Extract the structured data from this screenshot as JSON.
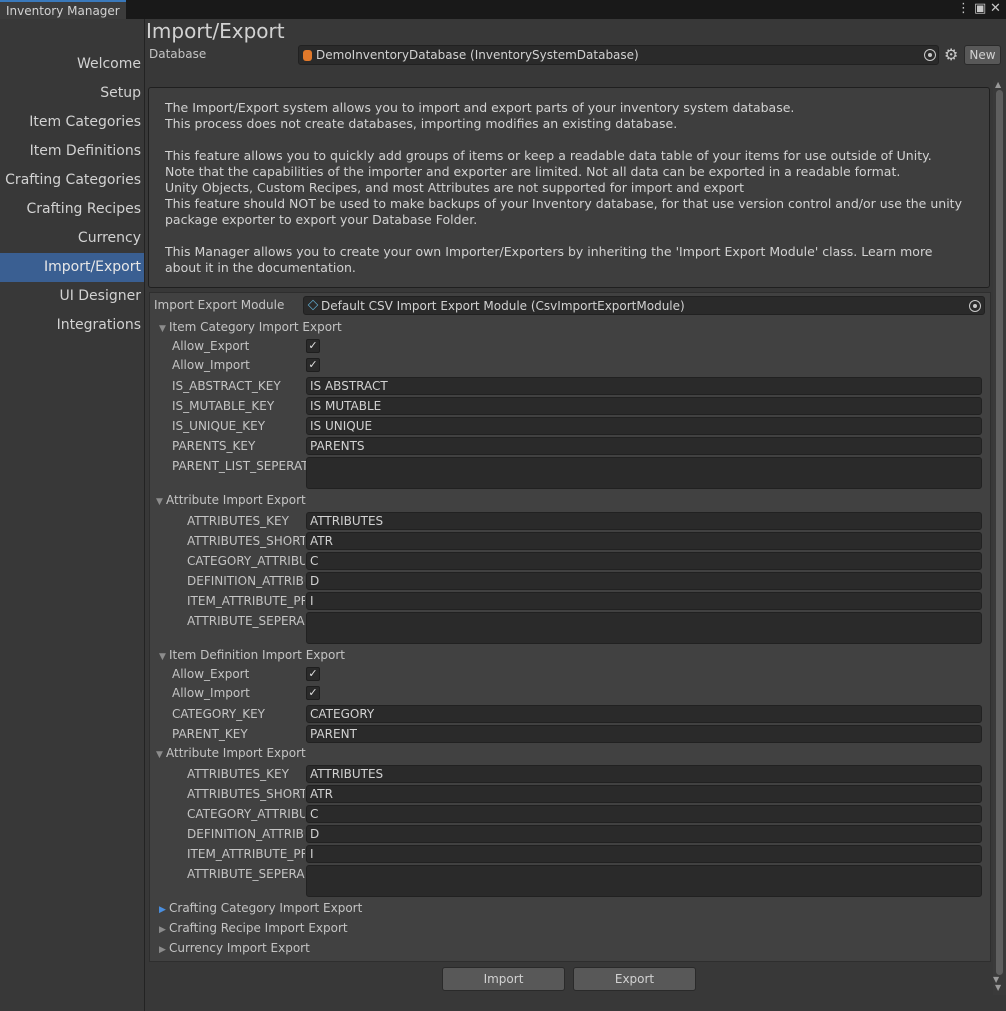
{
  "window": {
    "tab_title": "Inventory Manager",
    "menu_icon": "kebab-menu-icon",
    "maximize_icon": "maximize-icon",
    "close_icon": "close-icon"
  },
  "sidebar": {
    "items": [
      {
        "label": "Welcome"
      },
      {
        "label": "Setup"
      },
      {
        "label": "Item Categories"
      },
      {
        "label": "Item Definitions"
      },
      {
        "label": "Crafting Categories"
      },
      {
        "label": "Crafting Recipes"
      },
      {
        "label": "Currency"
      },
      {
        "label": "Import/Export",
        "active": true
      },
      {
        "label": "UI Designer"
      },
      {
        "label": "Integrations"
      }
    ]
  },
  "header": {
    "title": "Import/Export",
    "database_label": "Database",
    "database_value": "DemoInventoryDatabase (InventorySystemDatabase)",
    "new_button": "New"
  },
  "help": {
    "lines": [
      "The Import/Export system allows you to import and export parts of your inventory system database.",
      "This process does not create databases, importing modifies an existing database.",
      "",
      "This feature allows you to quickly add groups of items or keep a readable data table of your items for use outside of Unity.",
      "Note that the capabilities of the importer and exporter are limited. Not all data can be exported in a readable format.",
      "Unity Objects, Custom Recipes, and most Attributes are not supported for import and export",
      "This feature should NOT be used to make backups of your Inventory database, for that use version control and/or use the unity",
      "package exporter to export your Database Folder.",
      "",
      "This Manager allows you to create your own Importer/Exporters by inheriting the 'Import Export Module' class. Learn more",
      "about it in the documentation."
    ]
  },
  "module": {
    "label": "Import Export Module",
    "value": "Default CSV Import Export Module (CsvImportExportModule)"
  },
  "item_category": {
    "header": "Item Category Import Export",
    "allow_export_label": "Allow_Export",
    "allow_export": true,
    "allow_import_label": "Allow_Import",
    "allow_import": true,
    "fields": [
      {
        "label": "IS_ABSTRACT_KEY",
        "value": "IS ABSTRACT"
      },
      {
        "label": "IS_MUTABLE_KEY",
        "value": "IS MUTABLE"
      },
      {
        "label": "IS_UNIQUE_KEY",
        "value": "IS UNIQUE"
      },
      {
        "label": "PARENTS_KEY",
        "value": "PARENTS"
      },
      {
        "label": "PARENT_LIST_SEPERAT",
        "value": ""
      }
    ],
    "attributes": {
      "header": "Attribute Import Export",
      "fields": [
        {
          "label": "ATTRIBUTES_KEY",
          "value": "ATTRIBUTES"
        },
        {
          "label": "ATTRIBUTES_SHORT",
          "value": "ATR"
        },
        {
          "label": "CATEGORY_ATTRIBU",
          "value": "C"
        },
        {
          "label": "DEFINITION_ATTRIBU",
          "value": "D"
        },
        {
          "label": "ITEM_ATTRIBUTE_PR",
          "value": "I"
        },
        {
          "label": "ATTRIBUTE_SEPERA",
          "value": ""
        }
      ]
    }
  },
  "item_definition": {
    "header": "Item Definition Import Export",
    "allow_export_label": "Allow_Export",
    "allow_export": true,
    "allow_import_label": "Allow_Import",
    "allow_import": true,
    "fields": [
      {
        "label": "CATEGORY_KEY",
        "value": "CATEGORY"
      },
      {
        "label": "PARENT_KEY",
        "value": "PARENT"
      }
    ],
    "attributes": {
      "header": "Attribute Import Export",
      "fields": [
        {
          "label": "ATTRIBUTES_KEY",
          "value": "ATTRIBUTES"
        },
        {
          "label": "ATTRIBUTES_SHORT",
          "value": "ATR"
        },
        {
          "label": "CATEGORY_ATTRIBU",
          "value": "C"
        },
        {
          "label": "DEFINITION_ATTRIBU",
          "value": "D"
        },
        {
          "label": "ITEM_ATTRIBUTE_PR",
          "value": "I"
        },
        {
          "label": "ATTRIBUTE_SEPERA",
          "value": ""
        }
      ]
    }
  },
  "collapsed_sections": [
    {
      "label": "Crafting Category Import Export"
    },
    {
      "label": "Crafting Recipe Import Export"
    },
    {
      "label": "Currency Import Export"
    }
  ],
  "buttons": {
    "import": "Import",
    "export": "Export"
  },
  "colors": {
    "accent": "#3a5f92",
    "background": "#383838",
    "field": "#2a2a2a"
  }
}
